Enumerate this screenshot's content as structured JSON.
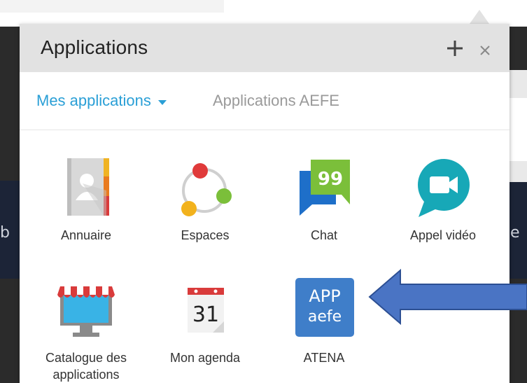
{
  "background": {
    "left_glyph": "b",
    "right_glyph": "e"
  },
  "panel": {
    "title": "Applications",
    "add_label": "+",
    "close_label": "×"
  },
  "tabs": {
    "mine": "Mes applications",
    "aefe": "Applications AEFE"
  },
  "apps": [
    {
      "label": "Annuaire",
      "icon": "address-book-icon"
    },
    {
      "label": "Espaces",
      "icon": "spaces-icon"
    },
    {
      "label": "Chat",
      "icon": "chat-icon"
    },
    {
      "label": "Appel vidéo",
      "icon": "video-call-icon"
    },
    {
      "label": "Catalogue des applications",
      "icon": "catalog-shop-icon"
    },
    {
      "label": "Mon agenda",
      "icon": "calendar-icon",
      "icon_text": "31"
    },
    {
      "label": "ATENA",
      "icon": "app-aefe-icon",
      "icon_text_top": "APP",
      "icon_text_bottom": "aefe"
    }
  ],
  "colors": {
    "accent": "#2a9fd6",
    "header_bg": "#e2e2e2",
    "arrow": "#4a74c4"
  }
}
